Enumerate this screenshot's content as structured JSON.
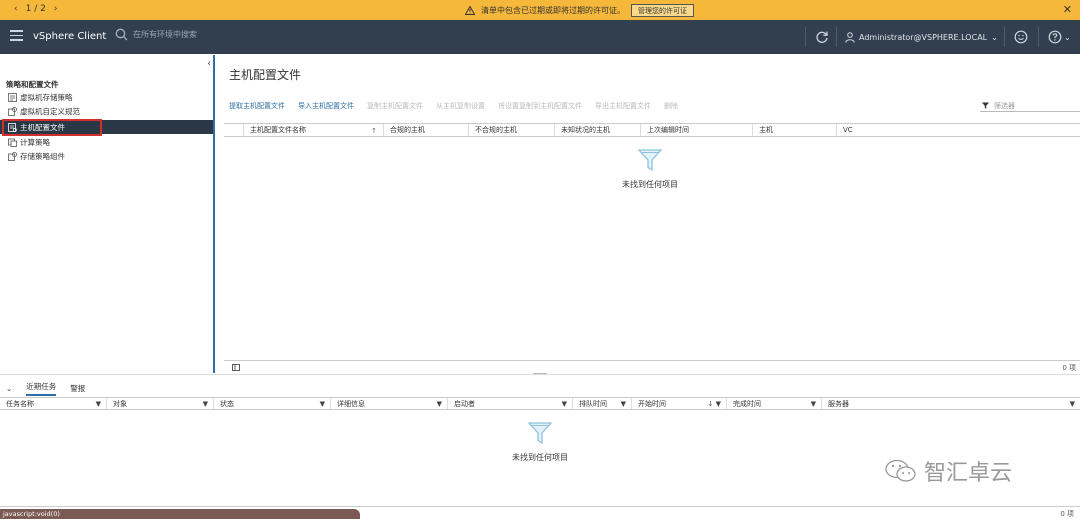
{
  "banner": {
    "pager": "1 / 2",
    "prev": "‹",
    "next": "›",
    "warning_icon": "warning-icon",
    "message": "清单中包含已过期或即将过期的许可证。",
    "manage_button": "管理您的许可证",
    "close": "✕"
  },
  "header": {
    "brand": "vSphere Client",
    "search_placeholder": "在所有环境中搜索",
    "user": "Administrator@VSPHERE.LOCAL",
    "user_caret": "⌄",
    "help_caret": "⌄"
  },
  "left": {
    "collapse": "‹",
    "tree_title": "策略和配置文件",
    "items": [
      {
        "label": "虚拟机存储策略",
        "icon": "storage-policy-icon"
      },
      {
        "label": "虚拟机自定义规范",
        "icon": "customization-spec-icon"
      },
      {
        "label": "主机配置文件",
        "icon": "host-profile-icon",
        "selected": true
      },
      {
        "label": "计算策略",
        "icon": "compute-policy-icon"
      },
      {
        "label": "存储策略组件",
        "icon": "storage-component-icon"
      }
    ]
  },
  "main": {
    "title": "主机配置文件",
    "toolbar": [
      {
        "label": "提取主机配置文件",
        "enabled": true
      },
      {
        "label": "导入主机配置文件",
        "enabled": true
      },
      {
        "label": "复制主机配置文件",
        "enabled": false
      },
      {
        "label": "从主机复制设置",
        "enabled": false
      },
      {
        "label": "将设置复制到主机配置文件",
        "enabled": false
      },
      {
        "label": "导出主机配置文件",
        "enabled": false
      },
      {
        "label": "删除",
        "enabled": false
      }
    ],
    "filter_placeholder": "筛选器",
    "columns": [
      "主机配置文件名称",
      "合规的主机",
      "不合规的主机",
      "未知状况的主机",
      "上次编辑时间",
      "主机",
      "VC"
    ],
    "sort_indicator": "↑",
    "empty_text": "未找到任何项目",
    "count": "0 项"
  },
  "bottom": {
    "collapse": "⌄",
    "tabs": [
      "近期任务",
      "警报"
    ],
    "columns": [
      "任务名称",
      "对象",
      "状态",
      "详细信息",
      "启动者",
      "排队时间",
      "开始时间",
      "完成时间",
      "服务器"
    ],
    "sort_indicator": "↓",
    "empty_text": "未找到任何项目",
    "count": "0 项",
    "status_url": "javascript:void(0)"
  },
  "watermark": "智汇卓云",
  "colors": {
    "banner": "#f5b83b",
    "header": "#313f4e",
    "accent": "#2d6fa6",
    "selected": "#2a3845"
  }
}
